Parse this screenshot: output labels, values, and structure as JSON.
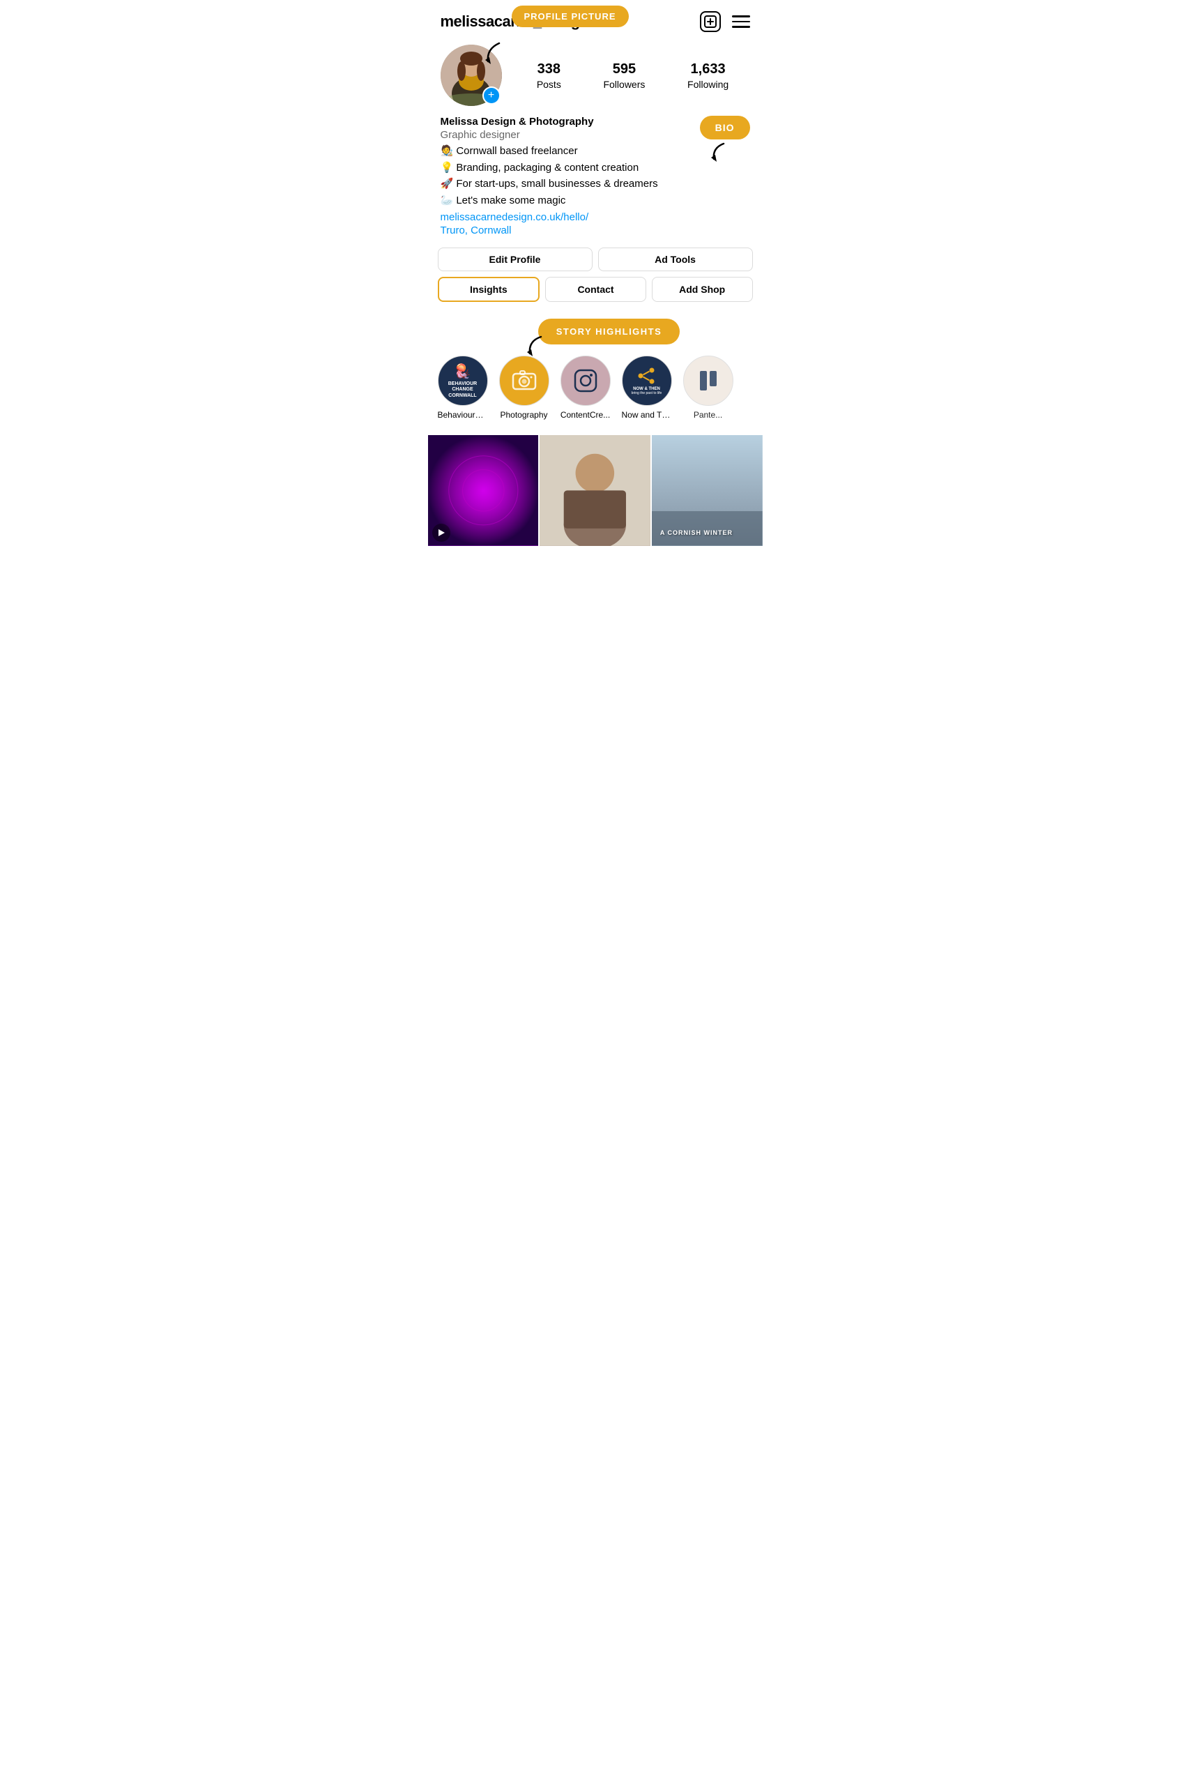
{
  "header": {
    "username": "melissacarne_design",
    "add_icon_label": "+",
    "menu_aria": "Menu"
  },
  "annotations": {
    "profile_picture_label": "PROFILE PICTURE",
    "bio_label": "BIO",
    "story_highlights_label": "STORY HIGHLIGHTS"
  },
  "stats": {
    "posts_count": "338",
    "posts_label": "Posts",
    "followers_count": "595",
    "followers_label": "Followers",
    "following_count": "1,633",
    "following_label": "Following"
  },
  "bio": {
    "name": "Melissa Design & Photography",
    "job": "Graphic designer",
    "line1": "🧑‍🎨 Cornwall based freelancer",
    "line2": "💡 Branding, packaging & content creation",
    "line3": "🚀 For start-ups, small businesses & dreamers",
    "line4": "🦢 Let's make some magic",
    "link": "melissacarnedesign.co.uk/hello/",
    "location": "Truro, Cornwall"
  },
  "buttons": {
    "edit_profile": "Edit Profile",
    "ad_tools": "Ad Tools",
    "insights": "Insights",
    "contact": "Contact",
    "add_shop": "Add Shop"
  },
  "highlights": {
    "title": "STORY HIGHLIGHTS",
    "items": [
      {
        "label": "BehaviourC...",
        "type": "behaviour"
      },
      {
        "label": "Photography",
        "type": "photography"
      },
      {
        "label": "ContentCre...",
        "type": "content"
      },
      {
        "label": "Now and Th...",
        "type": "nowandthen"
      },
      {
        "label": "Pante...",
        "type": "pant"
      }
    ]
  },
  "posts": [
    {
      "type": "video",
      "style": "purple"
    },
    {
      "type": "image",
      "style": "beige"
    },
    {
      "type": "image",
      "style": "winter",
      "text": "A CORNISH WINTER"
    }
  ]
}
